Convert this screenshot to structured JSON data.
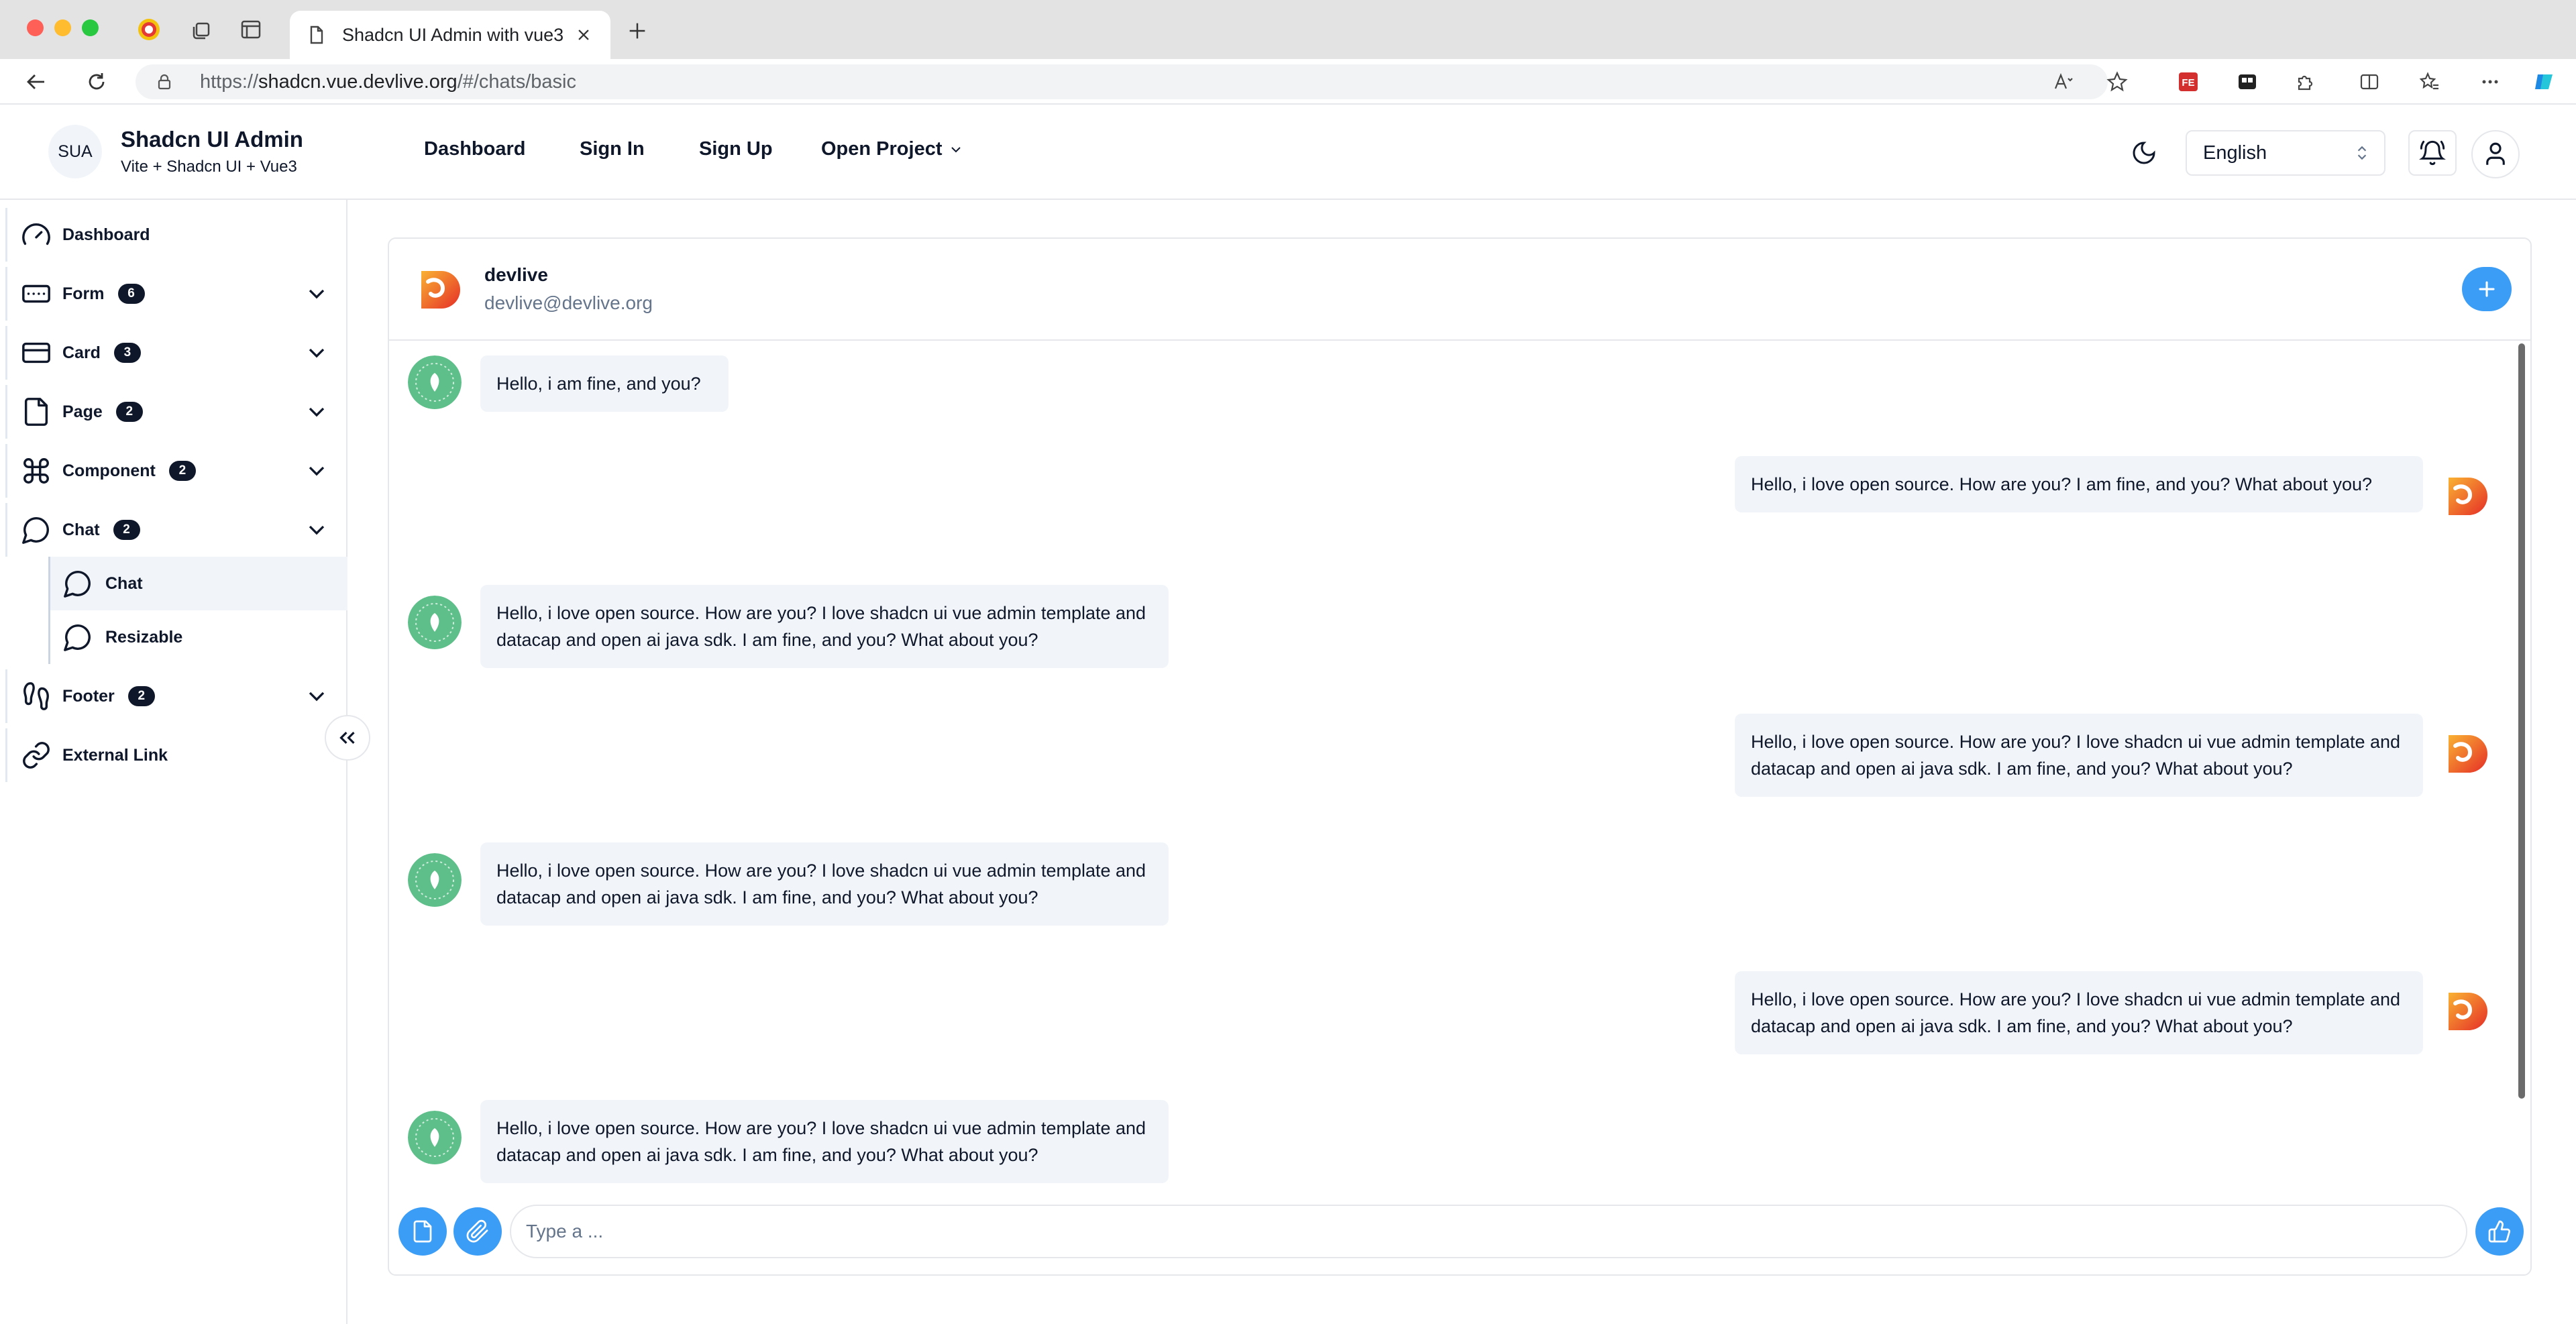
{
  "browser": {
    "tab_title": "Shadcn UI Admin with vue3",
    "url_prefix": "https://",
    "url_host": "shadcn.vue.devlive.org",
    "url_path": "/#/chats/basic",
    "extension_badge": "FE"
  },
  "brand": {
    "logo_text": "SUA",
    "title": "Shadcn UI Admin",
    "subtitle": "Vite + Shadcn UI + Vue3"
  },
  "sidebar": {
    "items": [
      {
        "label": "Dashboard",
        "badge": null,
        "icon": "gauge-icon"
      },
      {
        "label": "Form",
        "badge": "6",
        "icon": "keyboard-icon"
      },
      {
        "label": "Card",
        "badge": "3",
        "icon": "credit-card-icon"
      },
      {
        "label": "Page",
        "badge": "2",
        "icon": "file-icon"
      },
      {
        "label": "Component",
        "badge": "2",
        "icon": "command-icon"
      },
      {
        "label": "Chat",
        "badge": "2",
        "icon": "message-circle-icon"
      },
      {
        "label": "Footer",
        "badge": "2",
        "icon": "footprints-icon"
      },
      {
        "label": "External Link",
        "badge": null,
        "icon": "link-icon"
      }
    ],
    "chat_children": [
      {
        "label": "Chat",
        "active": true
      },
      {
        "label": "Resizable",
        "active": false
      }
    ]
  },
  "topnav": {
    "links": [
      "Dashboard",
      "Sign In",
      "Sign Up",
      "Open Project"
    ],
    "language": "English"
  },
  "chat": {
    "name": "devlive",
    "email": "devlive@devlive.org",
    "input_placeholder": "Type a ...",
    "messages": [
      {
        "side": "left",
        "text": "Hello, i am fine, and you?"
      },
      {
        "side": "right",
        "text": "Hello, i love open source. How are you? I am fine, and you? What about you?"
      },
      {
        "side": "left",
        "text": "Hello, i love open source. How are you? I love shadcn ui vue admin template and datacap and open ai java sdk. I am fine, and you? What about you?"
      },
      {
        "side": "right",
        "text": "Hello, i love open source. How are you? I love shadcn ui vue admin template and datacap and open ai java sdk. I am fine, and you? What about you?"
      },
      {
        "side": "left",
        "text": "Hello, i love open source. How are you? I love shadcn ui vue admin template and datacap and open ai java sdk. I am fine, and you? What about you?"
      },
      {
        "side": "right",
        "text": "Hello, i love open source. How are you? I love shadcn ui vue admin template and datacap and open ai java sdk. I am fine, and you? What about you?"
      },
      {
        "side": "left",
        "text": "Hello, i love open source. How are you? I love shadcn ui vue admin template and datacap and open ai java sdk. I am fine, and you? What about you?"
      }
    ]
  },
  "colors": {
    "primary_button": "#3b9df5",
    "bubble_bg": "#f1f5f9",
    "badge_bg": "#0f172a",
    "assistant_avatar": "#5fbf8a"
  }
}
